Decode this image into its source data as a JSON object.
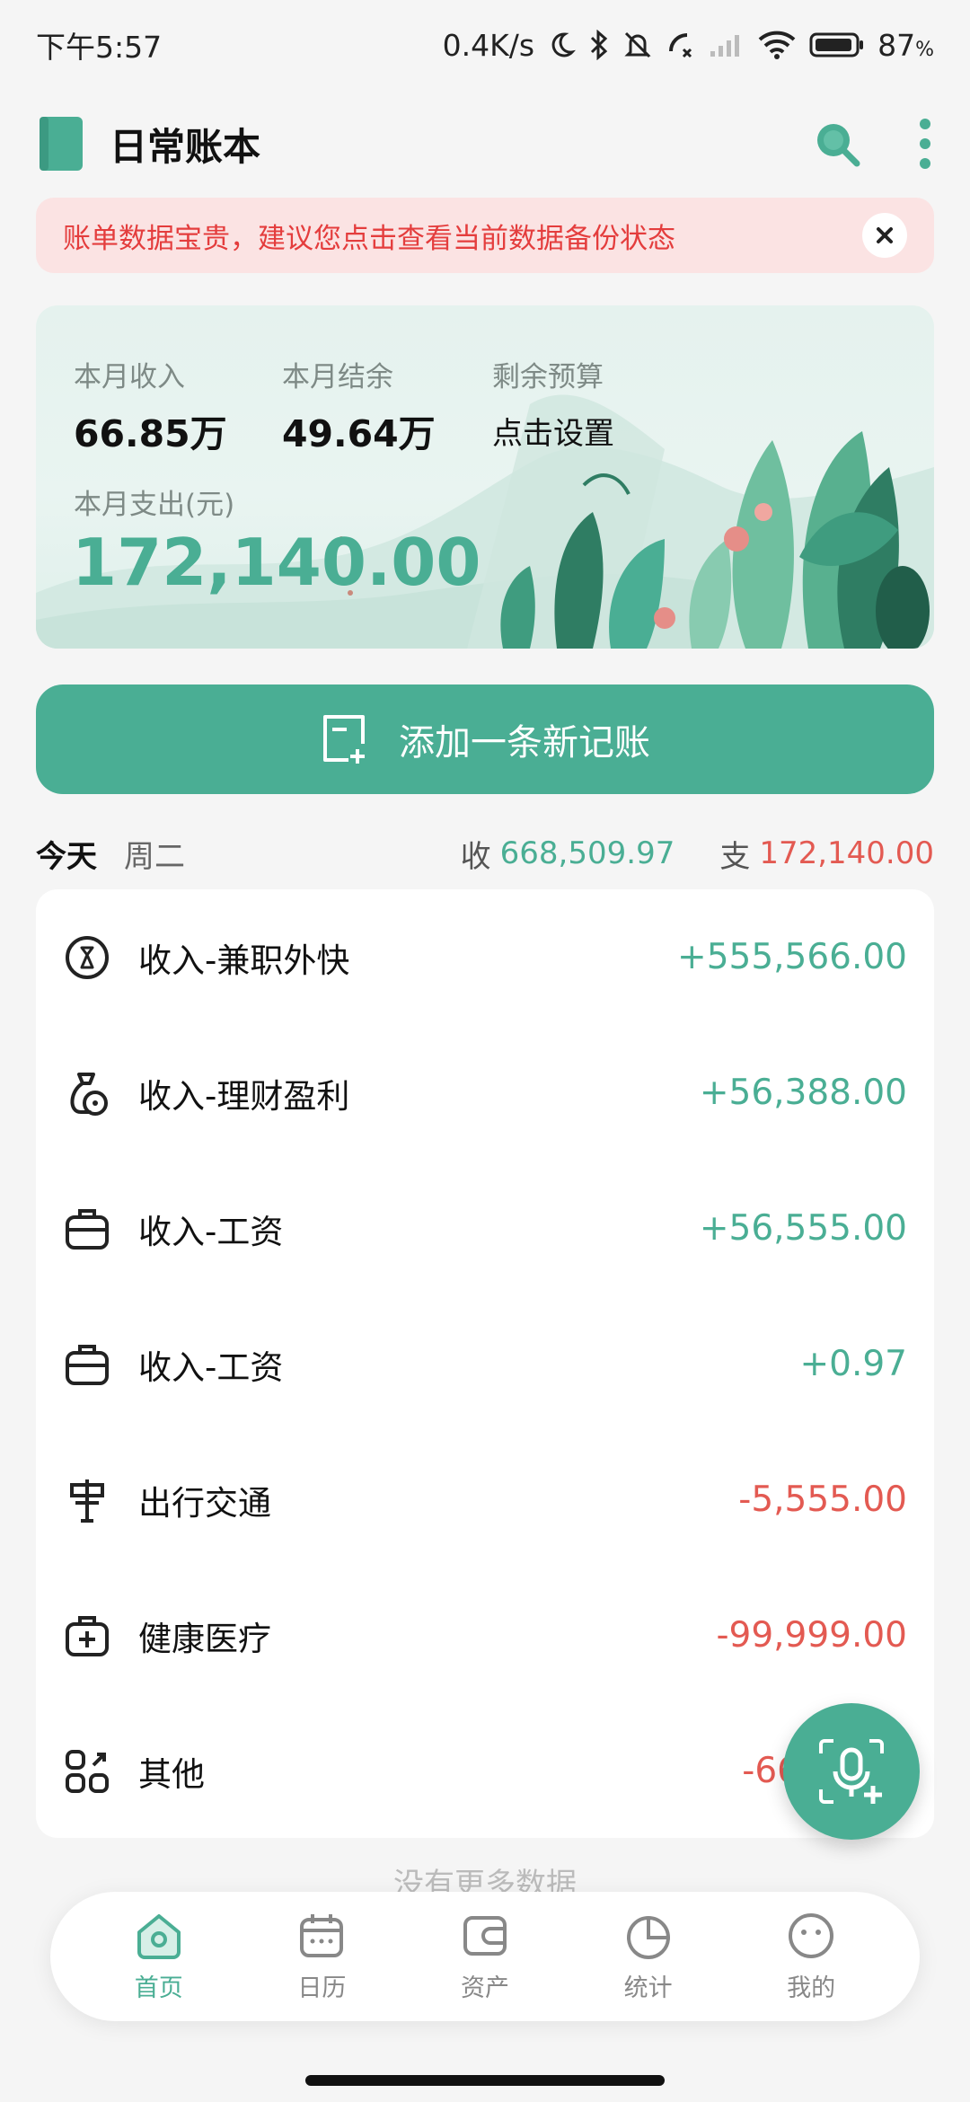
{
  "status_bar": {
    "time": "下午5:57",
    "network_speed": "0.4K/s",
    "battery": "87",
    "battery_unit": "%",
    "icons": [
      "moon-icon",
      "bluetooth-icon",
      "mute-icon",
      "call-icon",
      "signal-icon",
      "wifi-icon",
      "battery-icon"
    ]
  },
  "header": {
    "title": "日常账本",
    "icons": [
      "book-icon",
      "search-icon",
      "more-vertical-icon"
    ]
  },
  "banner": {
    "text": "账单数据宝贵，建议您点击查看当前数据备份状态"
  },
  "summary": {
    "income_label": "本月收入",
    "income_value": "66.85万",
    "balance_label": "本月结余",
    "balance_value": "49.64万",
    "budget_label": "剩余预算",
    "budget_value": "点击设置",
    "expense_label": "本月支出(元)",
    "expense_value": "172,140.00"
  },
  "add_button": {
    "label": "添加一条新记账"
  },
  "day": {
    "today": "今天",
    "weekday": "周二",
    "income_label": "收",
    "income_total": "668,509.97",
    "expense_label": "支",
    "expense_total": "172,140.00"
  },
  "transactions": [
    {
      "icon": "coin-icon",
      "name": "收入-兼职外快",
      "amount": "+555,566.00",
      "kind": "income"
    },
    {
      "icon": "money-bag-icon",
      "name": "收入-理财盈利",
      "amount": "+56,388.00",
      "kind": "income"
    },
    {
      "icon": "briefcase-icon",
      "name": "收入-工资",
      "amount": "+56,555.00",
      "kind": "income"
    },
    {
      "icon": "briefcase-icon",
      "name": "收入-工资",
      "amount": "+0.97",
      "kind": "income"
    },
    {
      "icon": "signpost-icon",
      "name": "出行交通",
      "amount": "-5,555.00",
      "kind": "expense"
    },
    {
      "icon": "medical-kit-icon",
      "name": "健康医疗",
      "amount": "-99,999.00",
      "kind": "expense"
    },
    {
      "icon": "apps-icon",
      "name": "其他",
      "amount": "-66",
      "kind": "expense"
    }
  ],
  "footer": {
    "no_more": "没有更多数据"
  },
  "nav": {
    "items": [
      {
        "label": "首页",
        "icon": "home-icon",
        "active": true
      },
      {
        "label": "日历",
        "icon": "calendar-icon",
        "active": false
      },
      {
        "label": "资产",
        "icon": "wallet-icon",
        "active": false
      },
      {
        "label": "统计",
        "icon": "pie-chart-icon",
        "active": false
      },
      {
        "label": "我的",
        "icon": "profile-icon",
        "active": false
      }
    ]
  },
  "colors": {
    "accent": "#4aae94",
    "expense": "#e35a52",
    "banner_bg": "#fbe3e3",
    "banner_text": "#e43d3d"
  }
}
